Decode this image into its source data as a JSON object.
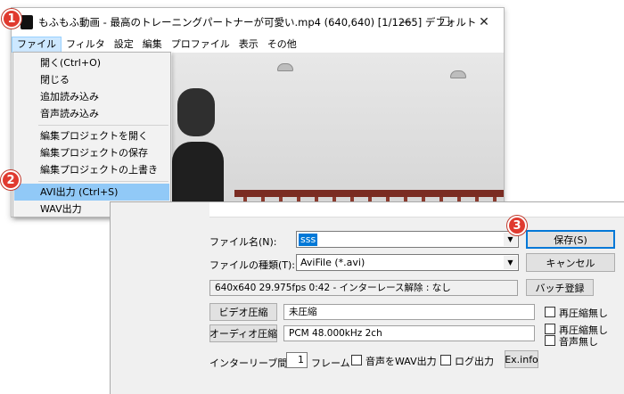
{
  "window": {
    "title": "もふもふ動画 - 最高のトレーニングパートナーが可愛い.mp4 (640,640)  [1/1265]  デフォルト",
    "controls": {
      "minimize": "—",
      "maximize": "☐",
      "close": "✕"
    }
  },
  "menubar": {
    "items": [
      "ファイル",
      "フィルタ",
      "設定",
      "編集",
      "プロファイル",
      "表示",
      "その他"
    ]
  },
  "file_menu": {
    "items": [
      "開く(Ctrl+O)",
      "閉じる",
      "追加読み込み",
      "音声読み込み",
      "編集プロジェクトを開く",
      "編集プロジェクトの保存",
      "編集プロジェクトの上書き",
      "AVI出力 (Ctrl+S)",
      "WAV出力"
    ]
  },
  "badges": {
    "one": "1",
    "two": "2",
    "three": "3"
  },
  "save_dialog": {
    "filename_label": "ファイル名(N):",
    "filename_value": "sss",
    "filetype_label": "ファイルの種類(T):",
    "filetype_value": "AviFile (*.avi)",
    "save_button": "保存(S)",
    "cancel_button": "キャンセル",
    "info_text": "640x640  29.975fps  0:42  -  インターレース解除 : なし",
    "batch_button": "バッチ登録",
    "video_compress_button": "ビデオ圧縮",
    "video_codec": "未圧縮",
    "recompress_none_video": "再圧縮無し",
    "audio_compress_button": "オーディオ圧縮",
    "audio_codec": "PCM 48.000kHz 2ch",
    "recompress_none_audio": "再圧縮無し",
    "no_audio": "音声無し",
    "interleave_label": "インターリーブ間隔 :",
    "interleave_value": "1",
    "frame_unit": "フレーム",
    "wav_output": "音声をWAV出力",
    "log_output": "ログ出力",
    "exinfo_button": "Ex.info"
  },
  "colors": {
    "highlight": "#91c9f7",
    "selection": "#0078d7",
    "badge": "#e03a2f"
  }
}
